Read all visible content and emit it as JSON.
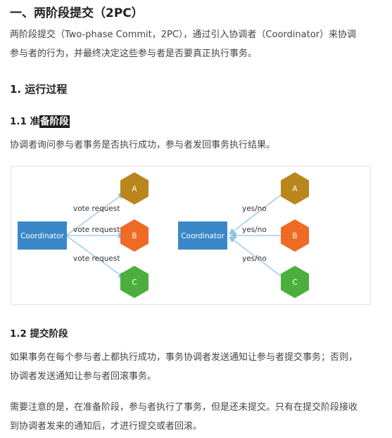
{
  "heading1": "一、两阶段提交（2PC）",
  "intro": {
    "line1": "两阶段提交（Two-phase Commit，2PC），通过引入协调者（Coordinator）来协调",
    "line2": "参与者的行为，并最终决定这些参与者是否要真正执行事务。"
  },
  "section1": {
    "title": "1. 运行过程"
  },
  "prepare": {
    "title_prefix": "1.1 准",
    "title_highlight": "备阶段",
    "text": "协调者询问参与者事务是否执行成功，参与者发回事务执行结果。"
  },
  "diagram": {
    "left": {
      "coordinator": "Coordinator",
      "labels": [
        "vote request",
        "vote request",
        "vote request"
      ]
    },
    "right": {
      "coordinator": "Coordinator",
      "labels": [
        "yes/no",
        "yes/no",
        "yes/no"
      ]
    },
    "participants": [
      {
        "name": "A",
        "color": "#b8861c"
      },
      {
        "name": "B",
        "color": "#ef6a24"
      },
      {
        "name": "C",
        "color": "#4caf3d"
      }
    ],
    "coordinator_color": "#3a87c8",
    "arrow_color": "#8ec3e6"
  },
  "commit": {
    "title": "1.2 提交阶段",
    "p1_line1": "如果事务在每个参与者上都执行成功，事务协调者发送通知让参与者提交事务；否则，",
    "p1_line2": "协调者发送通知让参与者回滚事务。",
    "p2_line1": "需要注意的是，在准备阶段，参与者执行了事务，但是还未提交。只有在提交阶段接收",
    "p2_line2": "到协调者发来的通知后，才进行提交或者回滚。"
  }
}
